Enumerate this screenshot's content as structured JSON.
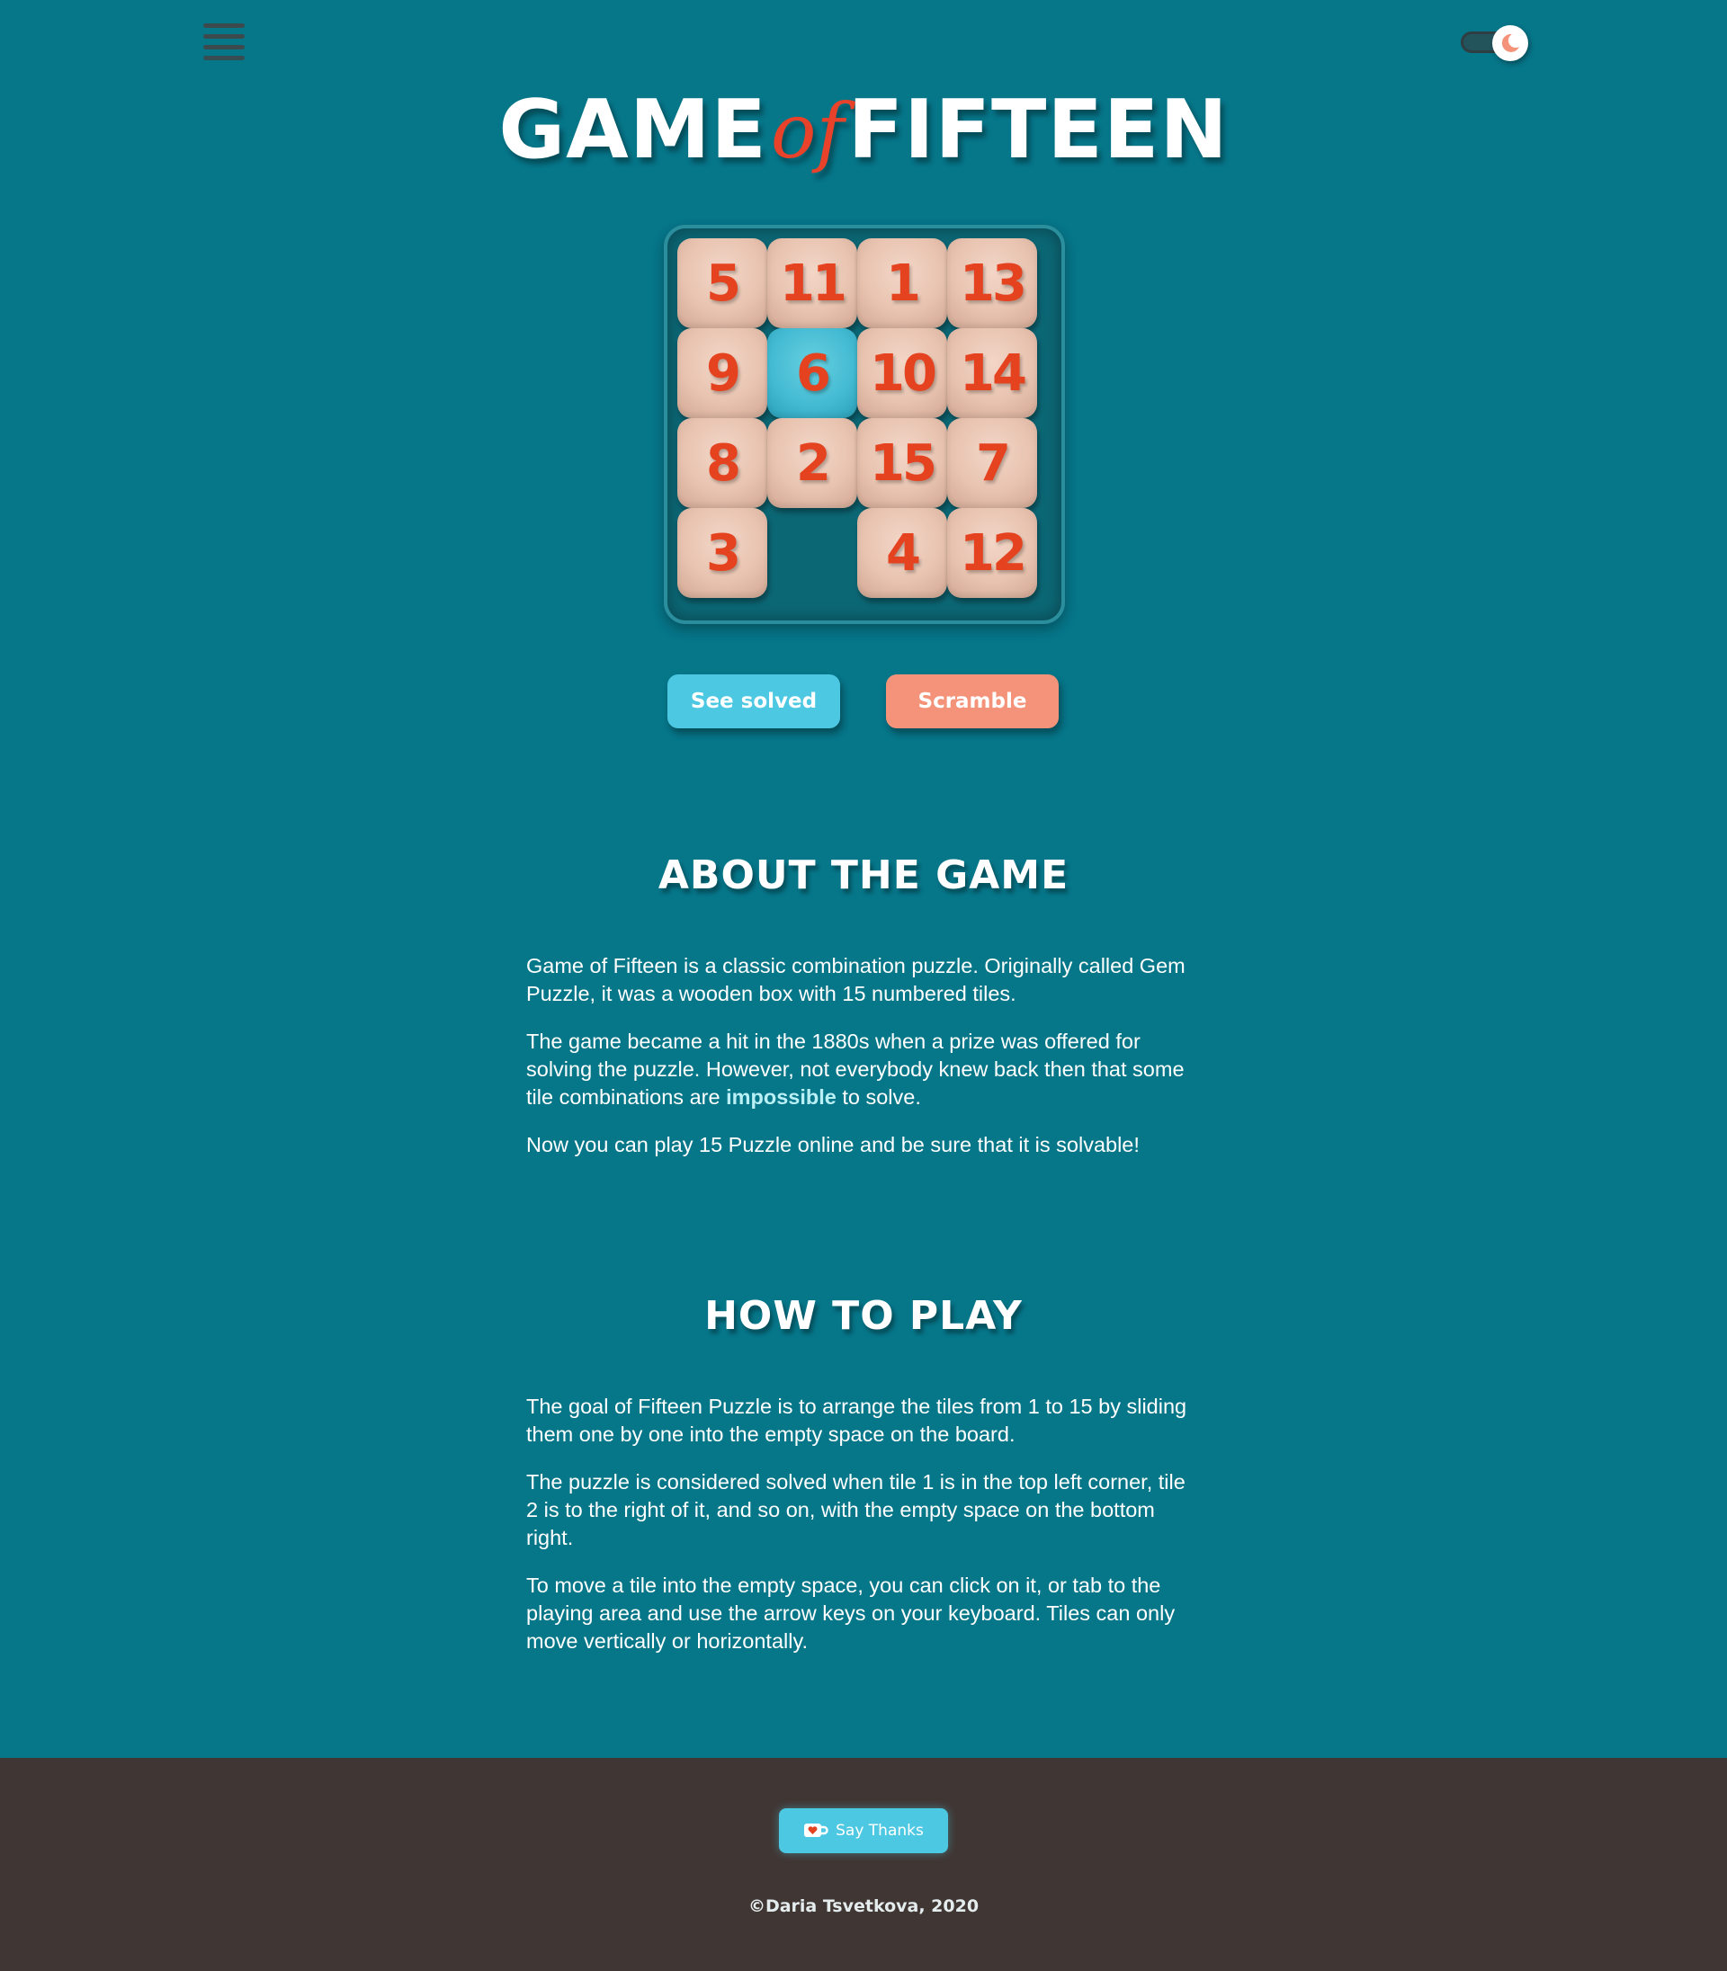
{
  "header": {
    "menu_icon": "hamburger-menu-icon",
    "theme_toggle_icon": "moon-icon"
  },
  "title": {
    "part1": "GAME",
    "part2": "of",
    "part3": "FIFTEEN"
  },
  "board": {
    "rows": [
      [
        "5",
        "11",
        "1",
        "13"
      ],
      [
        "9",
        "6",
        "10",
        "14"
      ],
      [
        "8",
        "2",
        "15",
        "7"
      ],
      [
        "3",
        "",
        "4",
        "12"
      ]
    ],
    "focused_tile": "6"
  },
  "buttons": {
    "see_solved": "See solved",
    "scramble": "Scramble"
  },
  "about": {
    "title": "ABOUT THE GAME",
    "p1": "Game of Fifteen is a classic combination puzzle. Originally called Gem Puzzle, it was a wooden box with 15 numbered tiles.",
    "p2_before": "The game became a hit in the 1880s when a prize was offered for solving the puzzle. However, not everybody knew back then that some tile combinations are ",
    "p2_highlight": "impossible",
    "p2_after": " to solve.",
    "p3": "Now you can play 15 Puzzle online and be sure that it is solvable!"
  },
  "howto": {
    "title": "HOW TO PLAY",
    "p1": "The goal of Fifteen Puzzle is to arrange the tiles from 1 to 15 by sliding them one by one into the empty space on the board.",
    "p2": "The puzzle is considered solved when tile 1 is in the top left corner, tile 2 is to the right of it, and so on, with the empty space on the bottom right.",
    "p3": "To move a tile into the empty space, you can click on it, or tab to the playing area and use the arrow keys on your keyboard. Tiles can only move vertically or horizontally."
  },
  "footer": {
    "thanks_label": "Say Thanks",
    "thanks_icon": "coffee-cup-heart-icon",
    "copyright": "©Daria Tsvetkova, 2020"
  },
  "colors": {
    "background": "#067689",
    "tile": "#e8c3b0",
    "tile_number": "#e5421f",
    "focused_tile": "#43bad2",
    "accent_blue": "#4dc8e2",
    "accent_coral": "#f49379",
    "footer": "#403633"
  }
}
